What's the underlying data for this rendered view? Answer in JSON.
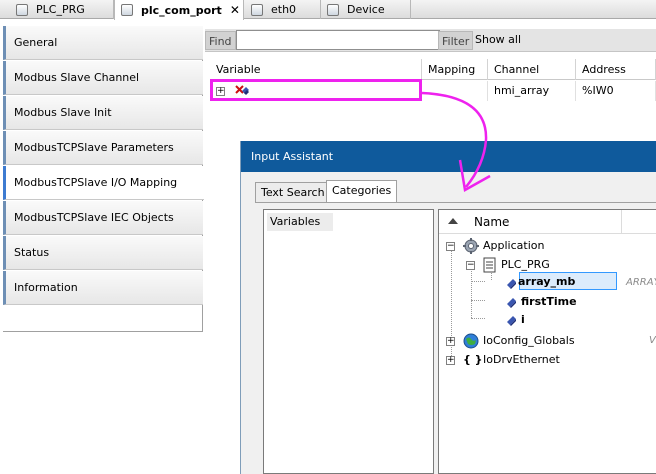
{
  "tabs": [
    {
      "label": "PLC_PRG",
      "active": false
    },
    {
      "label": "plc_com_port",
      "active": true
    },
    {
      "label": "eth0",
      "active": false
    },
    {
      "label": "Device",
      "active": false
    }
  ],
  "sidenav": {
    "items": [
      {
        "label": "General"
      },
      {
        "label": "Modbus Slave Channel"
      },
      {
        "label": "Modbus Slave Init"
      },
      {
        "label": "ModbusTCPSlave Parameters"
      },
      {
        "label": "ModbusTCPSlave I/O Mapping"
      },
      {
        "label": "ModbusTCPSlave IEC Objects"
      },
      {
        "label": "Status"
      },
      {
        "label": "Information"
      }
    ],
    "active_index": 4
  },
  "filterbar": {
    "find_label": "Find",
    "find_value": "",
    "filter_label": "Filter",
    "filter_value": "Show all"
  },
  "mapping_table": {
    "columns": [
      "Variable",
      "Mapping",
      "Channel",
      "Address"
    ],
    "rows": [
      {
        "variable": "",
        "mapping": "",
        "channel": "hmi_array",
        "address": "%IW0"
      }
    ]
  },
  "input_assistant": {
    "title": "Input Assistant",
    "tabs": [
      {
        "label": "Text Search",
        "active": false
      },
      {
        "label": "Categories",
        "active": true
      }
    ],
    "categories": [
      "Variables"
    ],
    "tree_header": "Name",
    "tree": {
      "application": "Application",
      "plc_prg": "PLC_PRG",
      "vars": [
        "array_mb",
        "firstTime",
        "i"
      ],
      "selected_type": "ARRAY",
      "ioconfig": "IoConfig_Globals",
      "iodrv": "IoDrvEthernet",
      "trailing_mark": "V"
    }
  },
  "colors": {
    "highlight": "#ee22ee",
    "dialog_title": "#0f5a9c",
    "selection": "#3399ff"
  }
}
